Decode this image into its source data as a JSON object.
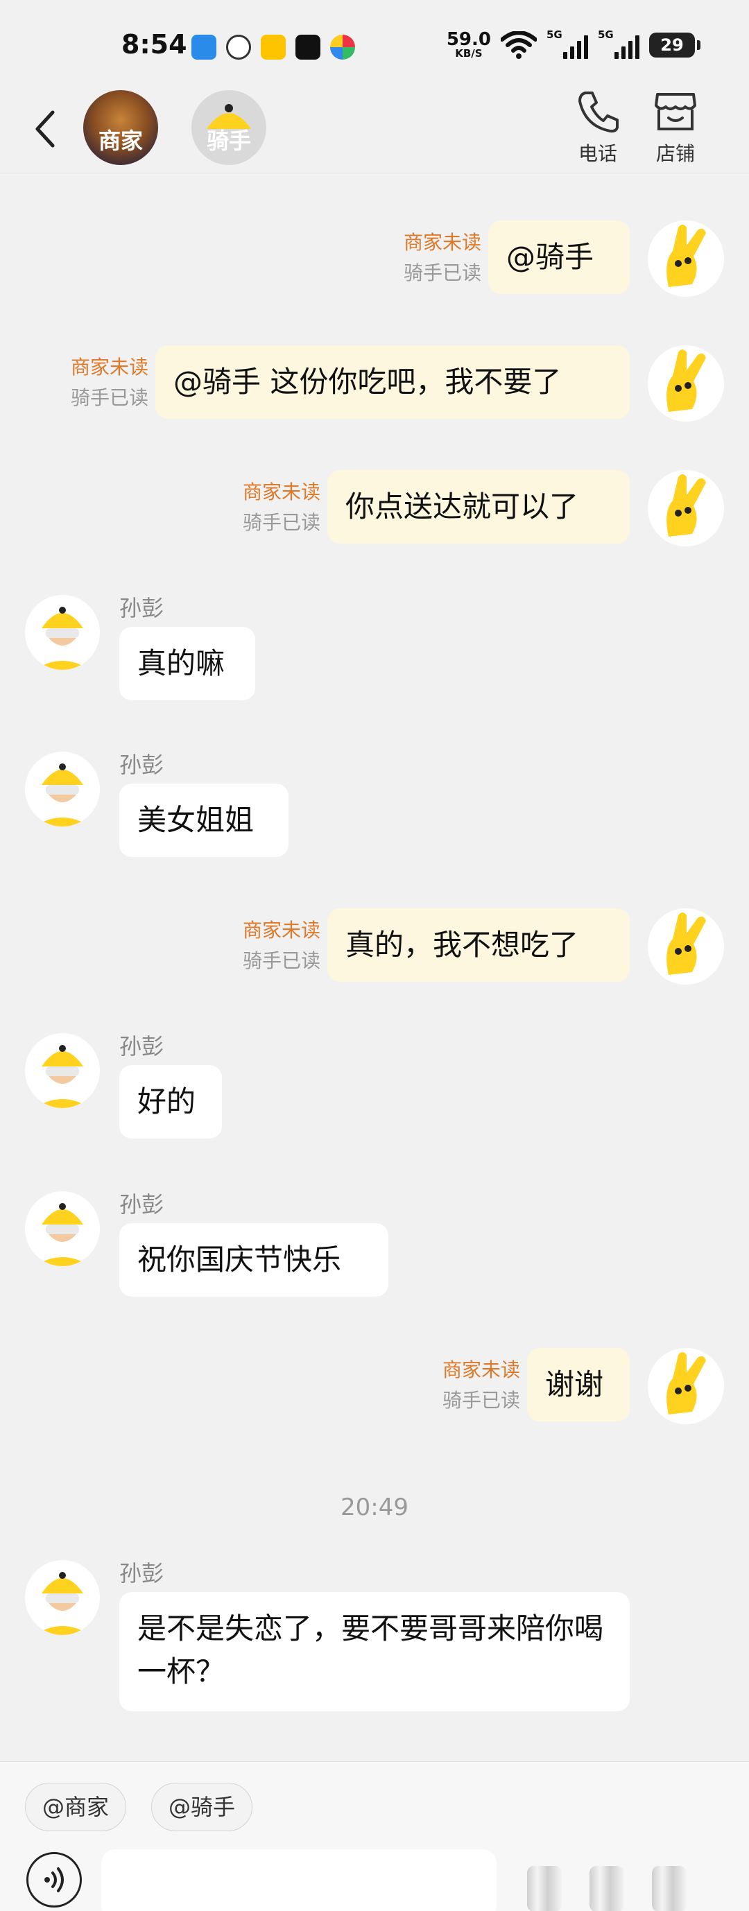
{
  "status_bar": {
    "time": "8:54",
    "net_speed_value": "59.0",
    "net_speed_unit": "KB/S",
    "signal_1_label": "5G",
    "signal_2_label": "5G",
    "battery_level": "29"
  },
  "header": {
    "merchant_label": "商家",
    "rider_label": "骑手",
    "phone_label": "电话",
    "shop_label": "店铺"
  },
  "messages": [
    {
      "dir": "out",
      "text": "@骑手",
      "unread": "商家未读",
      "read": "骑手已读"
    },
    {
      "dir": "out",
      "text": "@骑手 这份你吃吧，我不要了",
      "unread": "商家未读",
      "read": "骑手已读"
    },
    {
      "dir": "out",
      "text": "你点送达就可以了",
      "unread": "商家未读",
      "read": "骑手已读"
    },
    {
      "dir": "in",
      "sender": "孙彭",
      "text": "真的嘛"
    },
    {
      "dir": "in",
      "sender": "孙彭",
      "text": "美女姐姐"
    },
    {
      "dir": "out",
      "text": "真的，我不想吃了",
      "unread": "商家未读",
      "read": "骑手已读"
    },
    {
      "dir": "in",
      "sender": "孙彭",
      "text": "好的"
    },
    {
      "dir": "in",
      "sender": "孙彭",
      "text": "祝你国庆节快乐"
    },
    {
      "dir": "out",
      "text": "谢谢",
      "unread": "商家未读",
      "read": "骑手已读"
    },
    {
      "dir": "in",
      "sender": "孙彭",
      "text": "是不是失恋了，要不要哥哥来陪你喝一杯？"
    }
  ],
  "time_divider": "20:49",
  "bottom": {
    "chip_merchant": "@商家",
    "chip_rider": "@骑手"
  },
  "colors": {
    "outgoing_bubble": "#fdf7df",
    "incoming_bubble": "#ffffff",
    "unread_text": "#dd7a2a",
    "read_text": "#999999",
    "mascot_yellow": "#ffd21f",
    "background": "#f1f1f1"
  }
}
